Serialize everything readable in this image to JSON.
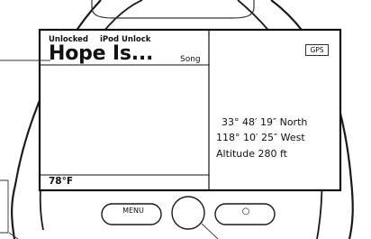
{
  "status": {
    "left": "Unlocked",
    "right": "iPod Unlock"
  },
  "now_playing": {
    "title": "Hope Is...",
    "type_label": "Song"
  },
  "weather": {
    "temperature": "78°F"
  },
  "gps": {
    "badge": "GPS",
    "latitude": "33° 48′ 19″ North",
    "longitude": "118° 10′ 25″ West",
    "altitude": "Altitude  280  ft"
  },
  "controls": {
    "menu_label": "MENU",
    "play_label": "○"
  }
}
